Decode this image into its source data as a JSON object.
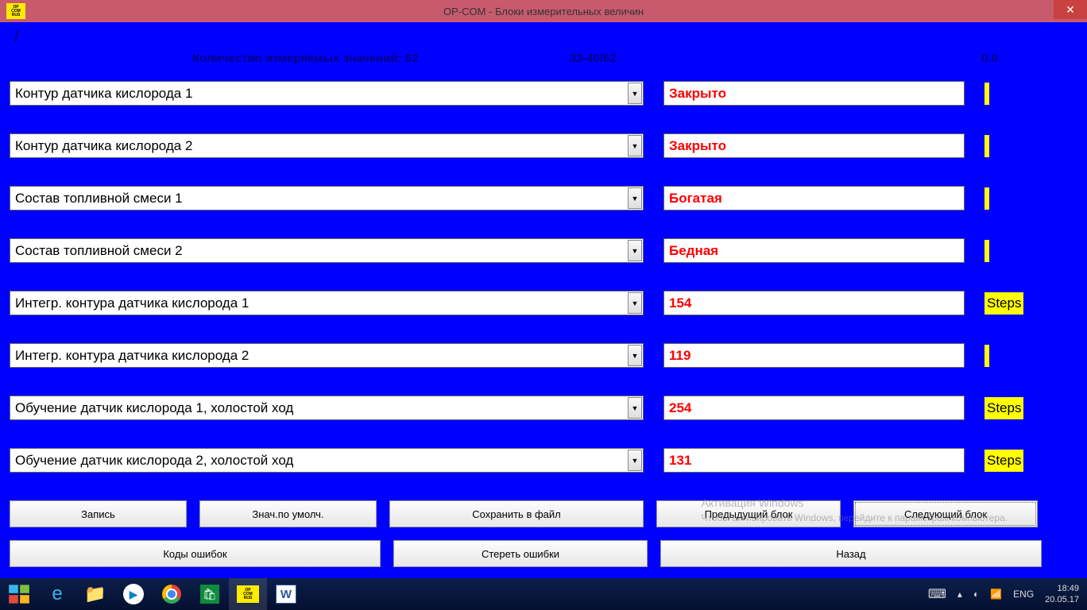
{
  "titlebar": {
    "title": "OP-COM - Блоки измерительных величин",
    "icon_lines": [
      "OP",
      "COM",
      "RUS"
    ]
  },
  "header": {
    "slash": "/",
    "count_label": "Количество измеряемых значений: 62",
    "range": "33-40/62",
    "speed": "0.0"
  },
  "rows": [
    {
      "param": "Контур датчика кислорода 1",
      "value": "Закрыто",
      "unit": ""
    },
    {
      "param": "Контур датчика кислорода 2",
      "value": "Закрыто",
      "unit": ""
    },
    {
      "param": "Состав топливной смеси 1",
      "value": "Богатая",
      "unit": ""
    },
    {
      "param": "Состав топливной смеси 2",
      "value": "Бедная",
      "unit": ""
    },
    {
      "param": "Интегр. контура датчика кислорода 1",
      "value": "154",
      "unit": "Steps"
    },
    {
      "param": "Интегр. контура датчика кислорода 2",
      "value": "119",
      "unit": ""
    },
    {
      "param": "Обучение датчик кислорода 1, холостой ход",
      "value": "254",
      "unit": "Steps"
    },
    {
      "param": "Обучение датчик кислорода 2, холостой ход",
      "value": "131",
      "unit": "Steps"
    }
  ],
  "buttons": {
    "record": "Запись",
    "defaults": "Знач.по умолч.",
    "save_file": "Сохранить в файл",
    "prev_block": "Предыдущий блок",
    "next_block": "Следующий блок",
    "error_codes": "Коды ошибок",
    "clear_errors": "Стереть ошибки",
    "back": "Назад"
  },
  "watermark": {
    "line1": "Активация Windows",
    "line2": "Чтобы активировать Windows, перейдите к параметрам компьютера."
  },
  "systray": {
    "lang": "ENG",
    "time": "18:49",
    "date": "20.05.17"
  }
}
